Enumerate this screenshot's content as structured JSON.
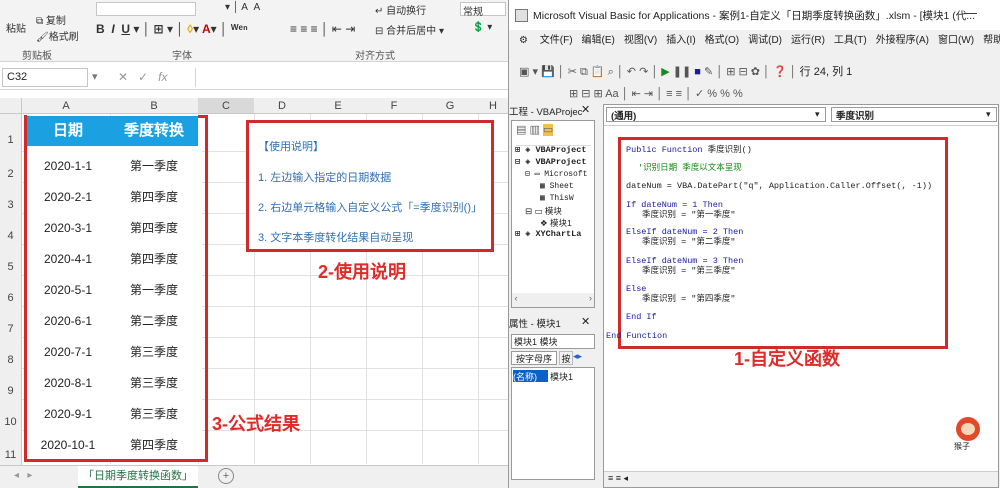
{
  "excel": {
    "ribbon": {
      "paste": "粘贴",
      "copy": "复制",
      "format_painter": "格式刷",
      "clipboard_group": "剪贴板",
      "font_group": "字体",
      "align_group": "对齐方式",
      "merge_center": "合并后居中",
      "wrap_text": "自动换行",
      "number_format": "常规"
    },
    "namebox": "C32",
    "columns": [
      "A",
      "B",
      "C",
      "D",
      "E",
      "F",
      "G",
      "H"
    ],
    "rows": [
      "1",
      "2",
      "3",
      "4",
      "5",
      "6",
      "7",
      "8",
      "9",
      "10",
      "11"
    ],
    "table": {
      "header_date": "日期",
      "header_quarter": "季度转换",
      "dates": [
        "2020-1-1",
        "2020-2-1",
        "2020-3-1",
        "2020-4-1",
        "2020-5-1",
        "2020-6-1",
        "2020-7-1",
        "2020-8-1",
        "2020-9-1",
        "2020-10-1"
      ],
      "quarters": [
        "第一季度",
        "第四季度",
        "第四季度",
        "第四季度",
        "第一季度",
        "第二季度",
        "第三季度",
        "第三季度",
        "第三季度",
        "第四季度"
      ]
    },
    "usage": {
      "title": "【使用说明】",
      "line1": "1. 左边输入指定的日期数据",
      "line2": "2. 右边单元格输入自定义公式「=季度识别()」",
      "line3": "3. 文字本季度转化结果自动呈现"
    },
    "labels": {
      "formula_result": "3-公式结果",
      "usage_label": "2-使用说明",
      "custom_func": "1-自定义函数"
    },
    "sheet_tab": "「日期季度转换函数」"
  },
  "vba": {
    "title": "Microsoft Visual Basic for Applications - 案例1-自定义「日期季度转换函数」.xlsm - [模块1 (代...",
    "menu": [
      "文件(F)",
      "编辑(E)",
      "视图(V)",
      "插入(I)",
      "格式(O)",
      "调试(D)",
      "运行(R)",
      "工具(T)",
      "外接程序(A)",
      "窗口(W)",
      "帮助"
    ],
    "position": "行 24, 列 1",
    "project_title": "工程 - VBAProjec",
    "tree": [
      "VBAProject",
      "VBAProject",
      "Microsoft",
      "Sheet",
      "ThisW",
      "模块",
      "模块1",
      "XYChartLa"
    ],
    "props_title": "属性 - 模块1",
    "props_combo": "模块1 模块",
    "props_tab1": "按字母序",
    "props_tab2": "按",
    "props_name": "(名称)",
    "props_value": "模块1",
    "combo_left": "(通用)",
    "combo_right": "季度识别",
    "code": {
      "l1": "Public Function 季度识别()",
      "l2": "'识别日期 季度以文本呈现",
      "l3": "dateNum = VBA.DatePart(\"q\", Application.Caller.Offset(, -1))",
      "l4": "If dateNum = 1 Then",
      "l5": "季度识别 = \"第一季度\"",
      "l6": "ElseIf dateNum = 2 Then",
      "l7": "季度识别 = \"第二季度\"",
      "l8": "ElseIf dateNum = 3 Then",
      "l9": "季度识别 = \"第三季度\"",
      "l10": "Else",
      "l11": "季度识别 = \"第四季度\"",
      "l12": "End If",
      "l13": "End Function"
    },
    "watermark": "猴子"
  }
}
